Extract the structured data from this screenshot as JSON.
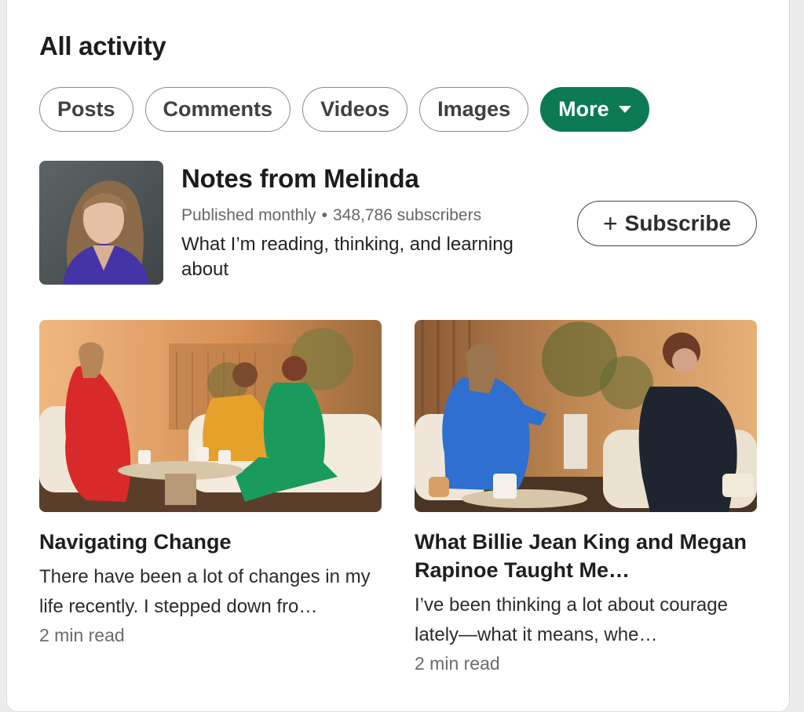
{
  "header": {
    "title": "All activity"
  },
  "filters": {
    "posts": "Posts",
    "comments": "Comments",
    "videos": "Videos",
    "images": "Images",
    "more": "More",
    "more_icon": "caret-down-icon"
  },
  "newsletter": {
    "name": "Notes from Melinda",
    "frequency": "Published monthly",
    "separator": "•",
    "subscribers": "348,786 subscribers",
    "description": "What I’m reading, thinking, and learning about",
    "subscribe_label": "Subscribe",
    "subscribe_icon": "plus-icon"
  },
  "articles": [
    {
      "title": "Navigating Change",
      "excerpt": "There have been a lot of changes in my life recently. I stepped down fro…",
      "read_time": "2 min read"
    },
    {
      "title": "What Billie Jean King and Megan Rapinoe Taught Me…",
      "excerpt": "I’ve been thinking a lot about courage lately—what it means, whe…",
      "read_time": "2 min read"
    }
  ],
  "colors": {
    "accent": "#0b7a53",
    "text": "#1f1f1f",
    "muted": "#666666"
  }
}
